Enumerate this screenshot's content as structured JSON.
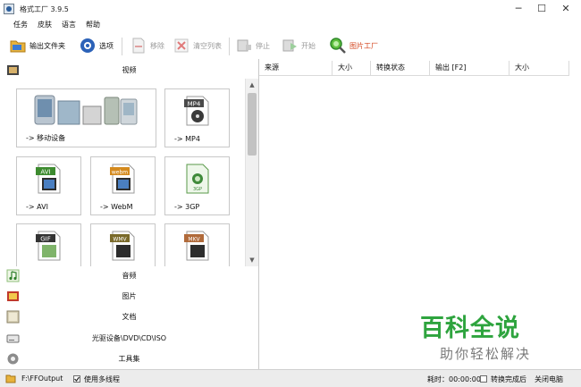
{
  "window": {
    "title": "格式工厂 3.9.5",
    "minimize": "─",
    "maximize": "☐",
    "close": "✕"
  },
  "menu": [
    "任务",
    "皮肤",
    "语言",
    "帮助"
  ],
  "toolbar": {
    "output_folder": "输出文件夹",
    "options": "选项",
    "remove": "移除",
    "clear_list": "清空列表",
    "stop": "停止",
    "start": "开始",
    "picture_factory": "图片工厂"
  },
  "categories": {
    "video": "视频",
    "audio": "音频",
    "picture": "图片",
    "document": "文档",
    "rom": "光驱设备\\DVD\\CD\\ISO",
    "tools": "工具集"
  },
  "tiles": {
    "mobile": {
      "label": "-> 移动设备"
    },
    "mp4": {
      "label": "-> MP4",
      "badge": "MP4"
    },
    "avi": {
      "label": "-> AVI",
      "badge": "AVI"
    },
    "webm": {
      "label": "-> WebM",
      "badge": "webm"
    },
    "threegp": {
      "label": "-> 3GP",
      "badge": "3GP"
    },
    "gif": {
      "badge": "GIF"
    },
    "wmv": {
      "badge": "WMV"
    },
    "mkv": {
      "badge": "MKV"
    }
  },
  "list_columns": [
    "来源",
    "大小",
    "转换状态",
    "输出 [F2]",
    "大小"
  ],
  "statusbar": {
    "output_path": "F:\\FFOutput",
    "multithread": "使用多线程",
    "elapsed": "耗时：00:00:00",
    "after_convert": "转换完成后",
    "shutdown": "关闭电脑"
  },
  "watermark": {
    "main": "百科全说",
    "sub": "助你轻松解决"
  },
  "colors": {
    "watermark_green": "#2ea43e",
    "statusbar_bg": "#ececec"
  }
}
